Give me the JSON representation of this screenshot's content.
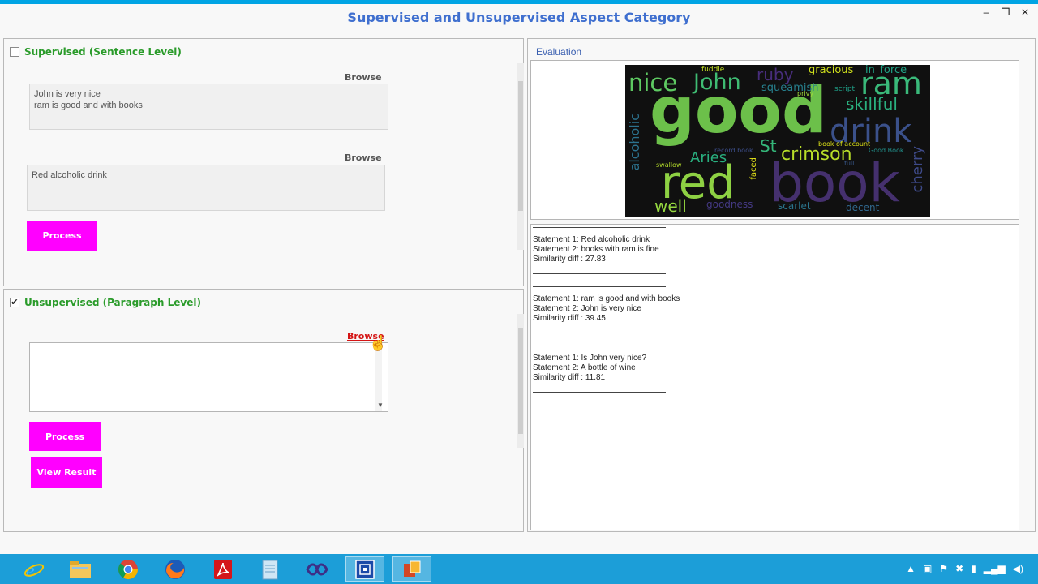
{
  "window": {
    "title": "Supervised and Unsupervised Aspect Category",
    "controls": [
      "–",
      "❐",
      "✕"
    ]
  },
  "supervised": {
    "checkbox_checked": false,
    "title": "Supervised (Sentence Level)",
    "browse1": "Browse",
    "textbox1": "John is very nice\nram is good and with books",
    "browse2": "Browse",
    "textbox2": "Red alcoholic drink",
    "process": "Process"
  },
  "unsupervised": {
    "checkbox_checked": true,
    "checkmark": "✔",
    "title": "Unsupervised (Paragraph Level)",
    "browse": "Browse",
    "textbox": "",
    "process": "Process",
    "view_result": "View Result"
  },
  "evaluation": {
    "label": "Evaluation",
    "wordcloud": [
      {
        "text": "good",
        "color": "#6cc04a"
      },
      {
        "text": "book",
        "color": "#45306e"
      },
      {
        "text": "red",
        "color": "#8ed143"
      },
      {
        "text": "nice",
        "color": "#5ec962"
      },
      {
        "text": "John",
        "color": "#3fbc73"
      },
      {
        "text": "ram",
        "color": "#3ab97a"
      },
      {
        "text": "drink",
        "color": "#3b518b"
      },
      {
        "text": "skillful",
        "color": "#2ab07f"
      },
      {
        "text": "crimson",
        "color": "#b8de29"
      },
      {
        "text": "Aries",
        "color": "#29af7f"
      },
      {
        "text": "St",
        "color": "#34b679"
      },
      {
        "text": "well",
        "color": "#95d840"
      },
      {
        "text": "alcoholic",
        "color": "#2c728e"
      },
      {
        "text": "cherry",
        "color": "#3e4a89"
      },
      {
        "text": "squeamish",
        "color": "#27808e"
      },
      {
        "text": "gracious",
        "color": "#d0e11c"
      },
      {
        "text": "in_force",
        "color": "#20a386"
      },
      {
        "text": "ruby",
        "color": "#472d7b"
      },
      {
        "text": "goodness",
        "color": "#443983"
      },
      {
        "text": "scarlet",
        "color": "#2a768e"
      },
      {
        "text": "decent",
        "color": "#31688e"
      },
      {
        "text": "fuddle",
        "color": "#c2df23"
      },
      {
        "text": "script",
        "color": "#1fa088"
      },
      {
        "text": "swallow",
        "color": "#b5de2b"
      },
      {
        "text": "book of account",
        "color": "#dde318"
      },
      {
        "text": "Good Book",
        "color": "#21918c"
      },
      {
        "text": "faced",
        "color": "#e5e419"
      },
      {
        "text": "record book",
        "color": "#3d4e8a"
      },
      {
        "text": "privy",
        "color": "#9fda3a"
      },
      {
        "text": "full",
        "color": "#38588c"
      }
    ],
    "results": [
      {
        "s1": "Statement 1: Red alcoholic drink",
        "s2": "Statement 2: books with ram is fine",
        "diff": "Similarity diff : 27.83"
      },
      {
        "s1": "Statement 1: ram is good and with books",
        "s2": "Statement 2: John is very nice",
        "diff": "Similarity diff : 39.45"
      },
      {
        "s1": "Statement 1: Is John very nice?",
        "s2": "Statement 2: A bottle of wine",
        "diff": "Similarity diff : 11.81"
      }
    ]
  },
  "taskbar": {
    "apps": [
      "ie-icon",
      "folder-icon",
      "chrome-icon",
      "firefox-icon",
      "acrobat-icon",
      "notepad-icon",
      "visual-studio-icon",
      "app-icon",
      "powerpoint-icon"
    ]
  }
}
